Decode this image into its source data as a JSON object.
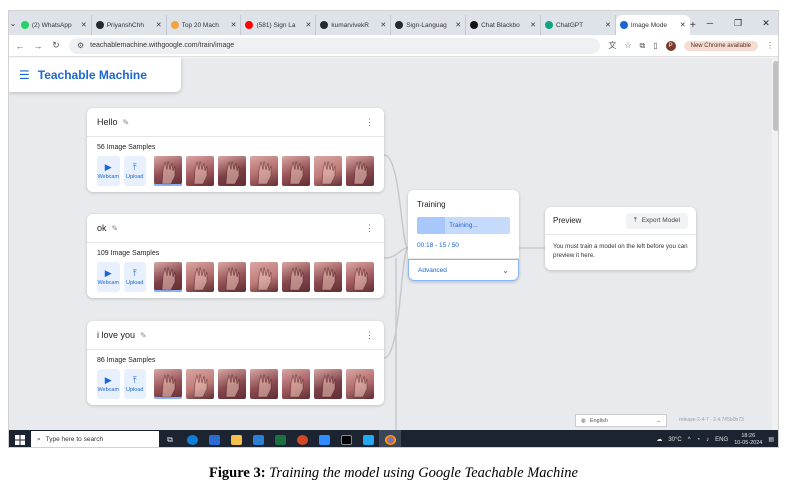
{
  "browser": {
    "tabs": [
      {
        "label": "(2) WhatsApp",
        "fav": "#25d366"
      },
      {
        "label": "PriyanshChh",
        "fav": "#24292f"
      },
      {
        "label": "Top 20 Mach",
        "fav": "#f4a340"
      },
      {
        "label": "(581) Sign La",
        "fav": "#ff0000"
      },
      {
        "label": "kumarvivekR",
        "fav": "#24292f"
      },
      {
        "label": "Sign-Languag",
        "fav": "#24292f"
      },
      {
        "label": "Chat Blackbo",
        "fav": "#111111"
      },
      {
        "label": "ChatGPT",
        "fav": "#10a37f"
      },
      {
        "label": "Image Mode",
        "fav": "#1967d2",
        "active": true
      }
    ],
    "url": "teachablemachine.withgoogle.com/train/image",
    "new_chrome_badge": "New Chrome available",
    "profile_initial": "P",
    "icons": {
      "tab_menu": "chevron-down-icon",
      "tab_close": "close-icon",
      "new_tab": "plus-icon",
      "back": "back-arrow-icon",
      "forward": "forward-arrow-icon",
      "reload": "reload-icon",
      "site_info": "site-info-icon",
      "translate": "translate-icon",
      "bookmark": "star-icon",
      "extensions": "puzzle-icon",
      "sidepanel": "side-panel-icon",
      "menu": "kebab-menu-icon"
    }
  },
  "app": {
    "title": "Teachable Machine",
    "accent_color": "#1967d2"
  },
  "classes": [
    {
      "name": "Hello",
      "samples_label": "56 Image Samples",
      "webcam_label": "Webcam",
      "upload_label": "Upload",
      "thumb_count": 7
    },
    {
      "name": "ok",
      "samples_label": "109 Image Samples",
      "webcam_label": "Webcam",
      "upload_label": "Upload",
      "thumb_count": 7
    },
    {
      "name": "i love you",
      "samples_label": "86 Image Samples",
      "webcam_label": "Webcam",
      "upload_label": "Upload",
      "thumb_count": 7
    }
  ],
  "training": {
    "title": "Training",
    "button_label": "Training...",
    "progress_text": "00:18 - 15 / 50",
    "progress_fraction": 0.3,
    "advanced_label": "Advanced"
  },
  "preview": {
    "title": "Preview",
    "export_label": "Export Model",
    "message": "You must train a model on the left before you can preview it here."
  },
  "footer": {
    "language": "English",
    "release": "release-2-4-7 · 2.4.7#5b0b73"
  },
  "taskbar": {
    "search_placeholder": "Type here to search",
    "weather": "30°C",
    "lang": "ENG",
    "time": "18:26",
    "date": "10-05-2024"
  },
  "caption": {
    "label": "Figure 3:",
    "text": "Training the model using Google Teachable Machine"
  }
}
